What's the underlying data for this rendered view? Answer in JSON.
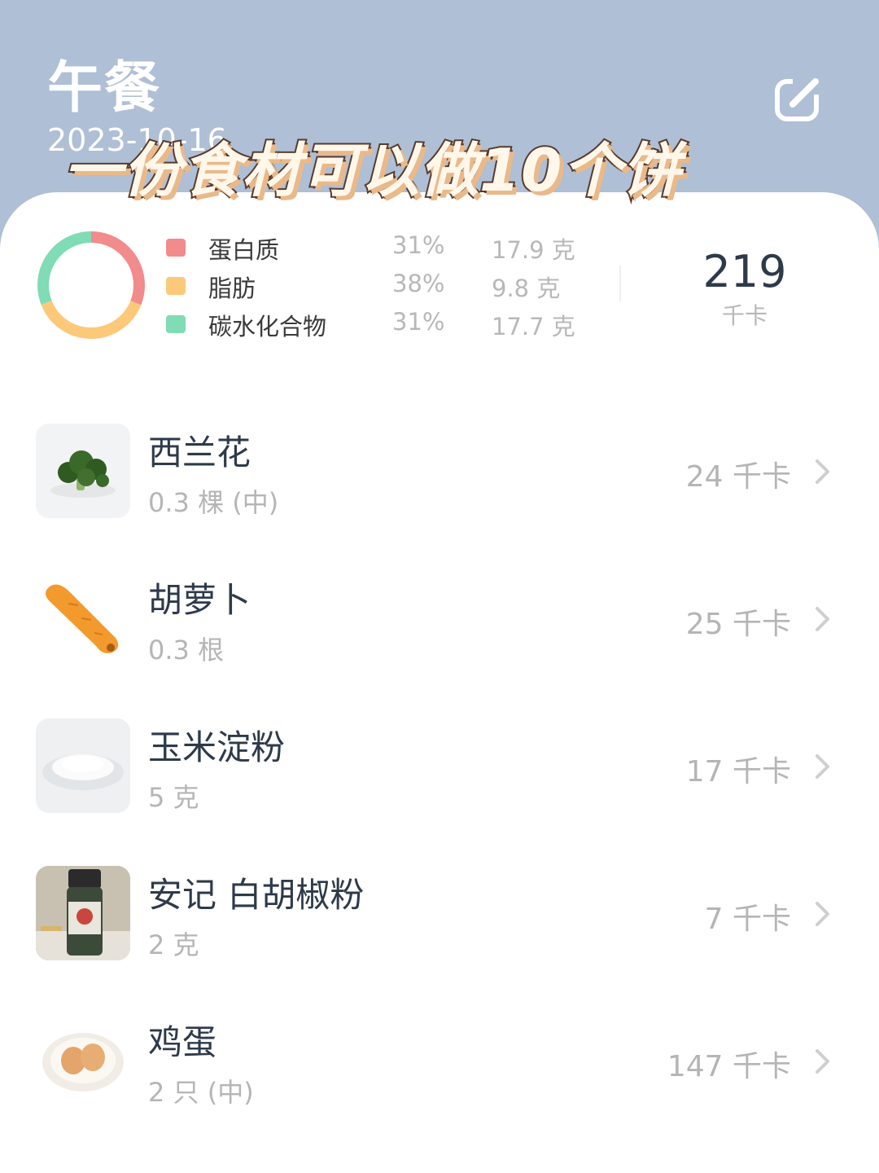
{
  "header": {
    "meal_title": "午餐",
    "date": "2023-10-16",
    "edit_icon": "edit-icon"
  },
  "overlay": {
    "caption": "一份食材可以做10个饼"
  },
  "summary": {
    "macros": [
      {
        "name": "蛋白质",
        "percent": "31%",
        "grams": "17.9 克",
        "color": "#f28b8b",
        "fraction": 0.31
      },
      {
        "name": "脂肪",
        "percent": "38%",
        "grams": "9.8 克",
        "color": "#fcc97a",
        "fraction": 0.38
      },
      {
        "name": "碳水化合物",
        "percent": "31%",
        "grams": "17.7 克",
        "color": "#7fdcb4",
        "fraction": 0.31
      }
    ],
    "total_kcal": "219",
    "kcal_unit": "千卡"
  },
  "foods": [
    {
      "name": "西兰花",
      "quantity": "0.3 棵 (中)",
      "kcal": "24 千卡",
      "icon": "broccoli-icon"
    },
    {
      "name": "胡萝卜",
      "quantity": "0.3 根",
      "kcal": "25 千卡",
      "icon": "carrot-icon"
    },
    {
      "name": "玉米淀粉",
      "quantity": "5 克",
      "kcal": "17 千卡",
      "icon": "cornstarch-icon"
    },
    {
      "name": "安记 白胡椒粉",
      "quantity": "2 克",
      "kcal": "7 千卡",
      "icon": "pepper-bottle-icon"
    },
    {
      "name": "鸡蛋",
      "quantity": "2 只 (中)",
      "kcal": "147 千卡",
      "icon": "eggs-icon"
    }
  ]
}
